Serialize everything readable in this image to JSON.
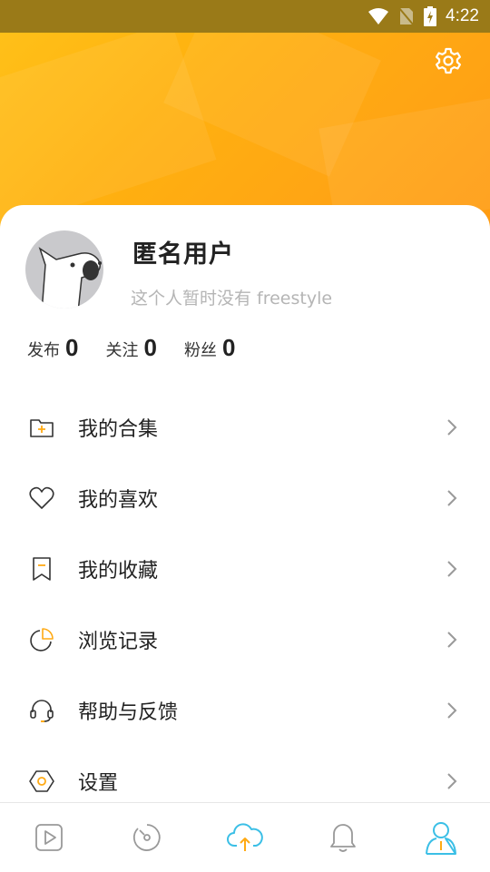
{
  "status_bar": {
    "time": "4:22"
  },
  "profile": {
    "username": "匿名用户",
    "bio": "这个人暂时没有 freestyle"
  },
  "stats": [
    {
      "label": "发布",
      "value": "0"
    },
    {
      "label": "关注",
      "value": "0"
    },
    {
      "label": "粉丝",
      "value": "0"
    }
  ],
  "menu": [
    {
      "label": "我的合集",
      "icon": "folder-plus-icon"
    },
    {
      "label": "我的喜欢",
      "icon": "heart-icon"
    },
    {
      "label": "我的收藏",
      "icon": "bookmark-icon"
    },
    {
      "label": "浏览记录",
      "icon": "history-pie-icon"
    },
    {
      "label": "帮助与反馈",
      "icon": "headset-icon"
    },
    {
      "label": "设置",
      "icon": "hexagon-settings-icon"
    }
  ],
  "bottom_nav": [
    {
      "icon": "play-icon",
      "active": false
    },
    {
      "icon": "disc-icon",
      "active": false
    },
    {
      "icon": "cloud-upload-icon",
      "active": false
    },
    {
      "icon": "bell-icon",
      "active": false
    },
    {
      "icon": "profile-icon",
      "active": true
    }
  ],
  "colors": {
    "accent": "#ffaa14",
    "active_nav": "#3bbfe6",
    "status_bar": "#9a7a18"
  }
}
